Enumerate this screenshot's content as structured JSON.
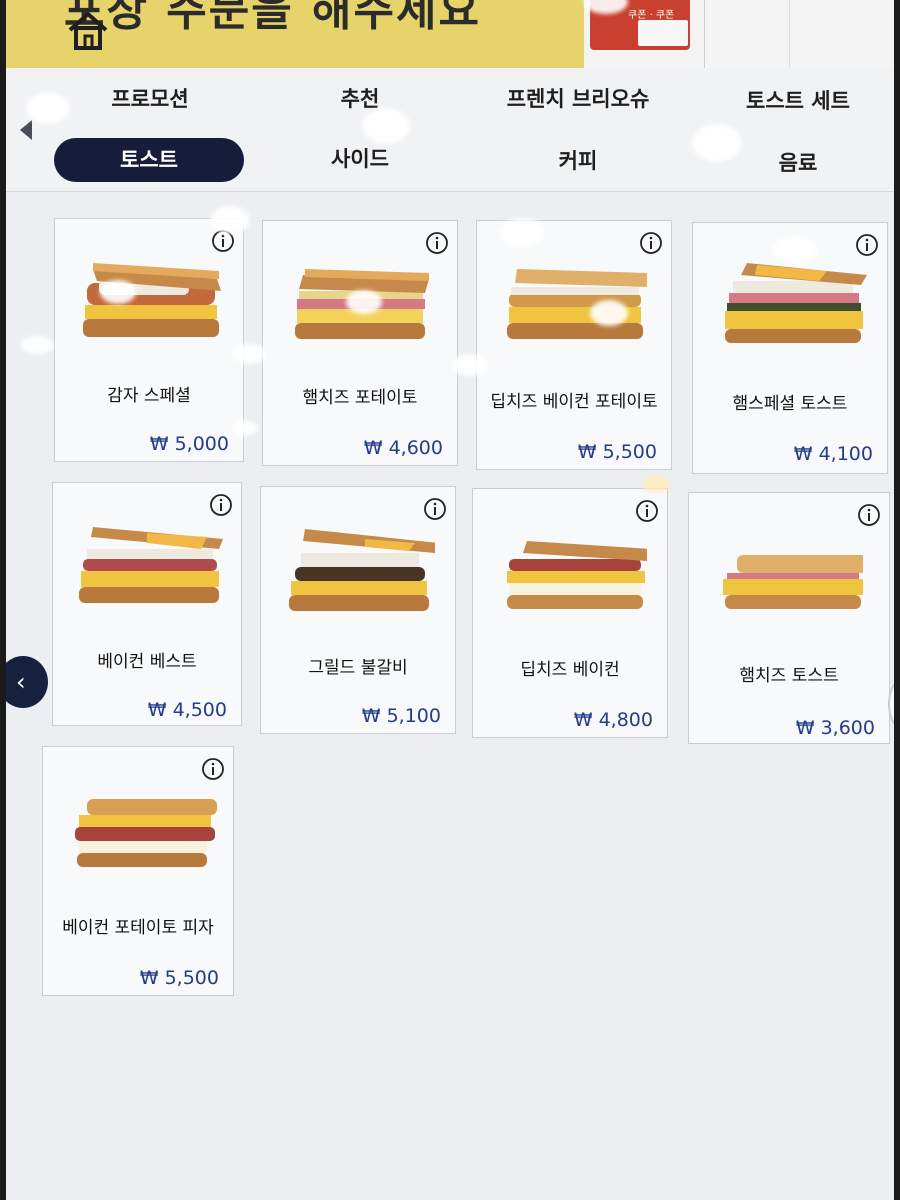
{
  "banner": {
    "title": "포장 주문을 해주세요",
    "coupon_label": "쿠폰 · 쿠폰"
  },
  "tabs": [
    {
      "label": "프로모션",
      "active": false
    },
    {
      "label": "추천",
      "active": false
    },
    {
      "label": "프렌치 브리오슈",
      "active": false
    },
    {
      "label": "토스트 세트",
      "active": false
    },
    {
      "label": "토스트",
      "active": true
    },
    {
      "label": "사이드",
      "active": false
    },
    {
      "label": "커피",
      "active": false
    },
    {
      "label": "음료",
      "active": false
    }
  ],
  "products": [
    {
      "name": "감자 스페셜",
      "price": "₩ 5,000"
    },
    {
      "name": "햄치즈 포테이토",
      "price": "₩ 4,600"
    },
    {
      "name": "딥치즈 베이컨 포테이토",
      "price": "₩ 5,500"
    },
    {
      "name": "햄스페셜 토스트",
      "price": "₩ 4,100"
    },
    {
      "name": "베이컨 베스트",
      "price": "₩ 4,500"
    },
    {
      "name": "그릴드 불갈비",
      "price": "₩ 5,100"
    },
    {
      "name": "딥치즈 베이컨",
      "price": "₩ 4,800"
    },
    {
      "name": "햄치즈 토스트",
      "price": "₩ 3,600"
    },
    {
      "name": "베이컨 포테이토 피자",
      "price": "₩ 5,500"
    }
  ],
  "icons": {
    "home": "home-icon",
    "info": "info-icon",
    "prev": "chevron-left-icon",
    "next": "chevron-right-icon"
  },
  "colors": {
    "active_tab": "#161d3b",
    "price": "#253c8c",
    "banner": "#e6d36a"
  }
}
